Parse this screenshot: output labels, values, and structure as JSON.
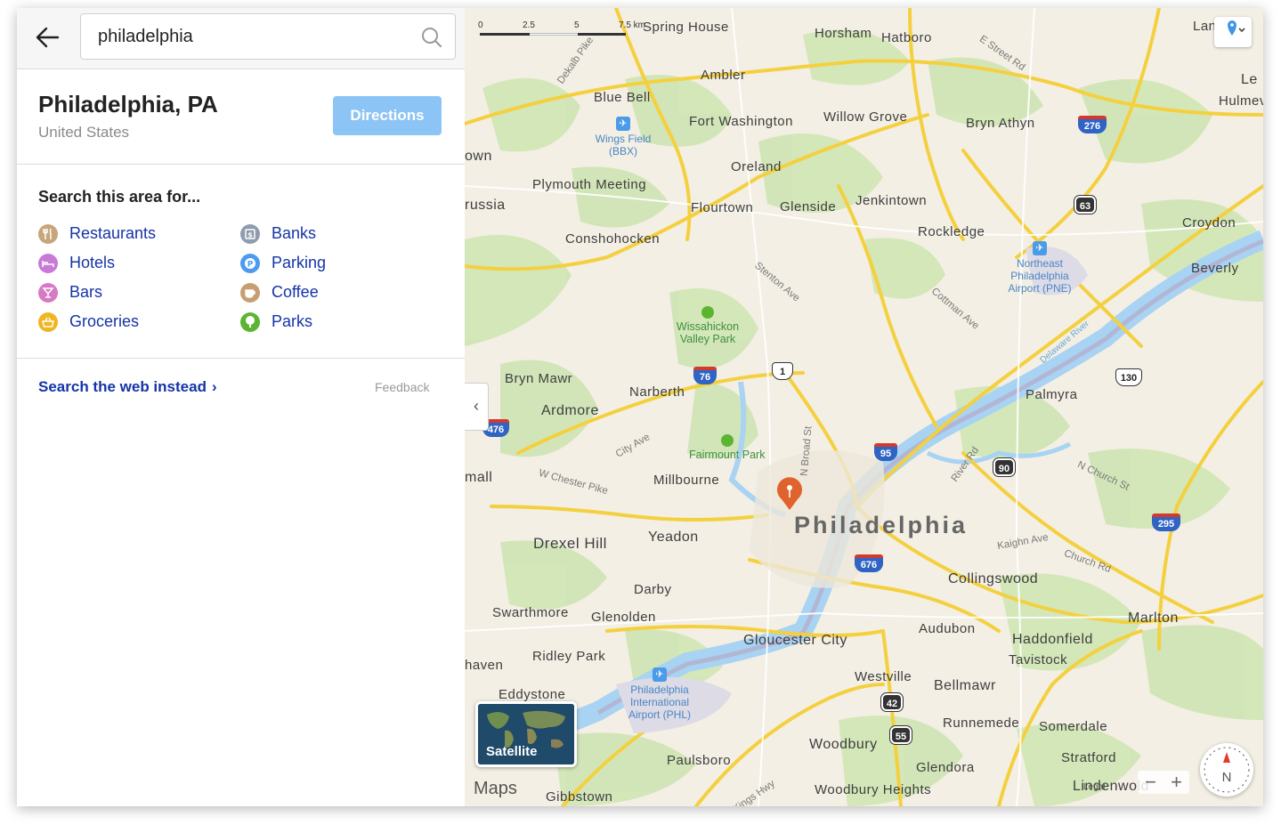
{
  "search": {
    "query": "philadelphia"
  },
  "place": {
    "title": "Philadelphia, PA",
    "subtitle": "United States",
    "directions_label": "Directions"
  },
  "categories": {
    "heading": "Search this area for...",
    "items": [
      {
        "label": "Restaurants",
        "icon": "fork-knife-icon",
        "color": "#c8a57a"
      },
      {
        "label": "Banks",
        "icon": "bank-icon",
        "color": "#8f9cae"
      },
      {
        "label": "Hotels",
        "icon": "bed-icon",
        "color": "#c77bd6"
      },
      {
        "label": "Parking",
        "icon": "parking-icon",
        "color": "#4d9bf0"
      },
      {
        "label": "Bars",
        "icon": "cocktail-icon",
        "color": "#d879c4"
      },
      {
        "label": "Coffee",
        "icon": "coffee-cup-icon",
        "color": "#c79e72"
      },
      {
        "label": "Groceries",
        "icon": "basket-icon",
        "color": "#f0b621"
      },
      {
        "label": "Parks",
        "icon": "tree-icon",
        "color": "#5cb531"
      }
    ]
  },
  "footer": {
    "web_search_label": "Search the web instead",
    "feedback_label": "Feedback"
  },
  "map": {
    "scale": [
      "0",
      "2.5",
      "5",
      "7.5 km"
    ],
    "city_label": "Philadelphia",
    "places": [
      "Spring House",
      "Horsham",
      "Hatboro",
      "Ambler",
      "Blue Bell",
      "Fort Washington",
      "Willow Grove",
      "Bryn Athyn",
      "Oreland",
      "Plymouth Meeting",
      "Flourtown",
      "Glenside",
      "Jenkintown",
      "Rockledge",
      "Croydon",
      "Conshohocken",
      "Beverly",
      "Bryn Mawr",
      "Narberth",
      "Ardmore",
      "Palmyra",
      "Millbourne",
      "Drexel Hill",
      "Yeadon",
      "Collingswood",
      "Darby",
      "Swarthmore",
      "Glenolden",
      "Audubon",
      "Haddonfield",
      "Marlton",
      "Gloucester City",
      "Tavistock",
      "Ridley Park",
      "Westville",
      "Bellmawr",
      "Eddystone",
      "Runnemede",
      "Somerdale",
      "Woodbury",
      "Paulsboro",
      "Glendora",
      "Stratford",
      "Gibbstown",
      "Woodbury Heights",
      "Lindenwold",
      "own",
      "russia",
      "mall",
      "haven",
      "Lan",
      "Hulmevi",
      "Le"
    ],
    "streets": [
      "E Street Rd",
      "Dekalb Pike",
      "Stenton Ave",
      "Cottman Ave",
      "City Ave",
      "W Chester Pike",
      "N Broad St",
      "River Rd",
      "N Church St",
      "Kaighn Ave",
      "Church Rd",
      "Kings Hwy",
      "Delaware River"
    ],
    "parks": [
      "Wissahickon Valley Park",
      "Fairmount Park"
    ],
    "airports": [
      "Wings Field (BBX)",
      "Northeast Philadelphia Airport (PNE)",
      "Philadelphia International Airport (PHL)"
    ],
    "shields": {
      "interstate": [
        "276",
        "76",
        "476",
        "95",
        "676",
        "295"
      ],
      "us": [
        "1",
        "130"
      ],
      "state": [
        "63",
        "90",
        "42",
        "55"
      ]
    },
    "satellite_label": "Satellite",
    "brand": "Maps",
    "legal": "Legal",
    "compass": "N",
    "zoom_out": "−",
    "zoom_in": "+"
  }
}
